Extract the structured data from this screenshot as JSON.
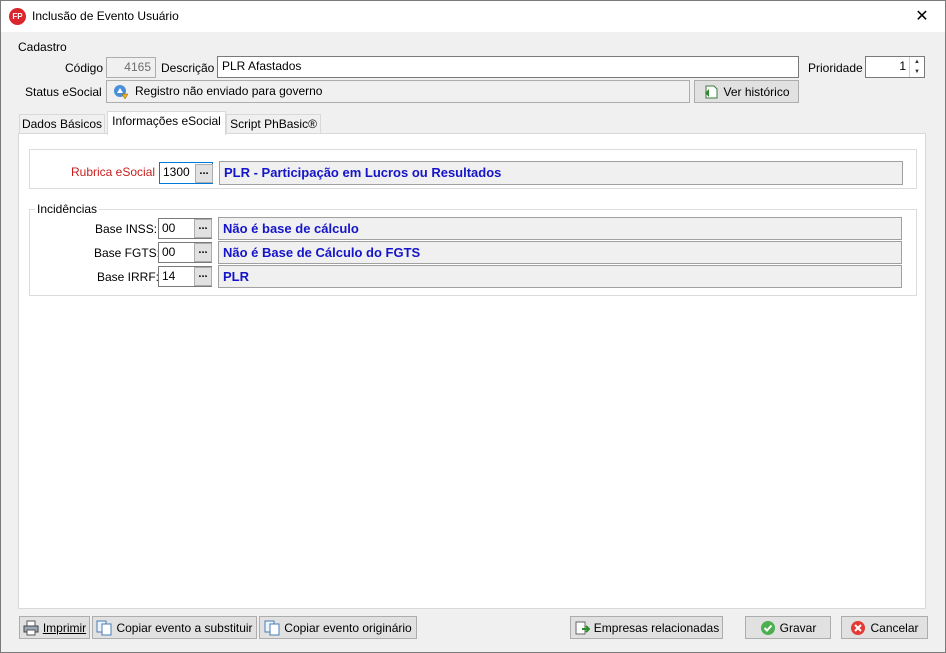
{
  "window": {
    "title": "Inclusão de Evento Usuário",
    "icon_text": "FP",
    "close_symbol": "✕"
  },
  "cadastro": {
    "group_title": "Cadastro",
    "codigo_label": "Código",
    "codigo_value": "4165",
    "descricao_label": "Descrição",
    "descricao_value": "PLR Afastados",
    "prioridade_label": "Prioridade",
    "prioridade_value": "1",
    "status_label": "Status eSocial",
    "status_value": "Registro não enviado para governo",
    "historico_button": "Ver histórico"
  },
  "tabs": [
    {
      "label": "Dados Básicos"
    },
    {
      "label": "Informações eSocial"
    },
    {
      "label": "Script PhBasic®"
    }
  ],
  "esocial": {
    "rubrica_label": "Rubrica eSocial",
    "rubrica_code": "1300",
    "rubrica_desc": "PLR - Participação em Lucros ou Resultados",
    "ellipsis": "...",
    "incidencias_title": "Incidências",
    "rows": [
      {
        "label": "Base INSS:",
        "code": "00",
        "desc": "Não é base de cálculo"
      },
      {
        "label": "Base FGTS:",
        "code": "00",
        "desc": "Não é Base de Cálculo do FGTS"
      },
      {
        "label": "Base IRRF:",
        "code": "14",
        "desc": "PLR"
      }
    ]
  },
  "footer": {
    "imprimir": "Imprimir",
    "copiar_substituir": "Copiar evento a substituir",
    "copiar_originario": "Copiar evento originário",
    "empresas": "Empresas relacionadas",
    "gravar": "Gravar",
    "cancelar": "Cancelar"
  },
  "colors": {
    "rubrica_label": "#c81e1e",
    "desc_text": "#1414c8"
  }
}
